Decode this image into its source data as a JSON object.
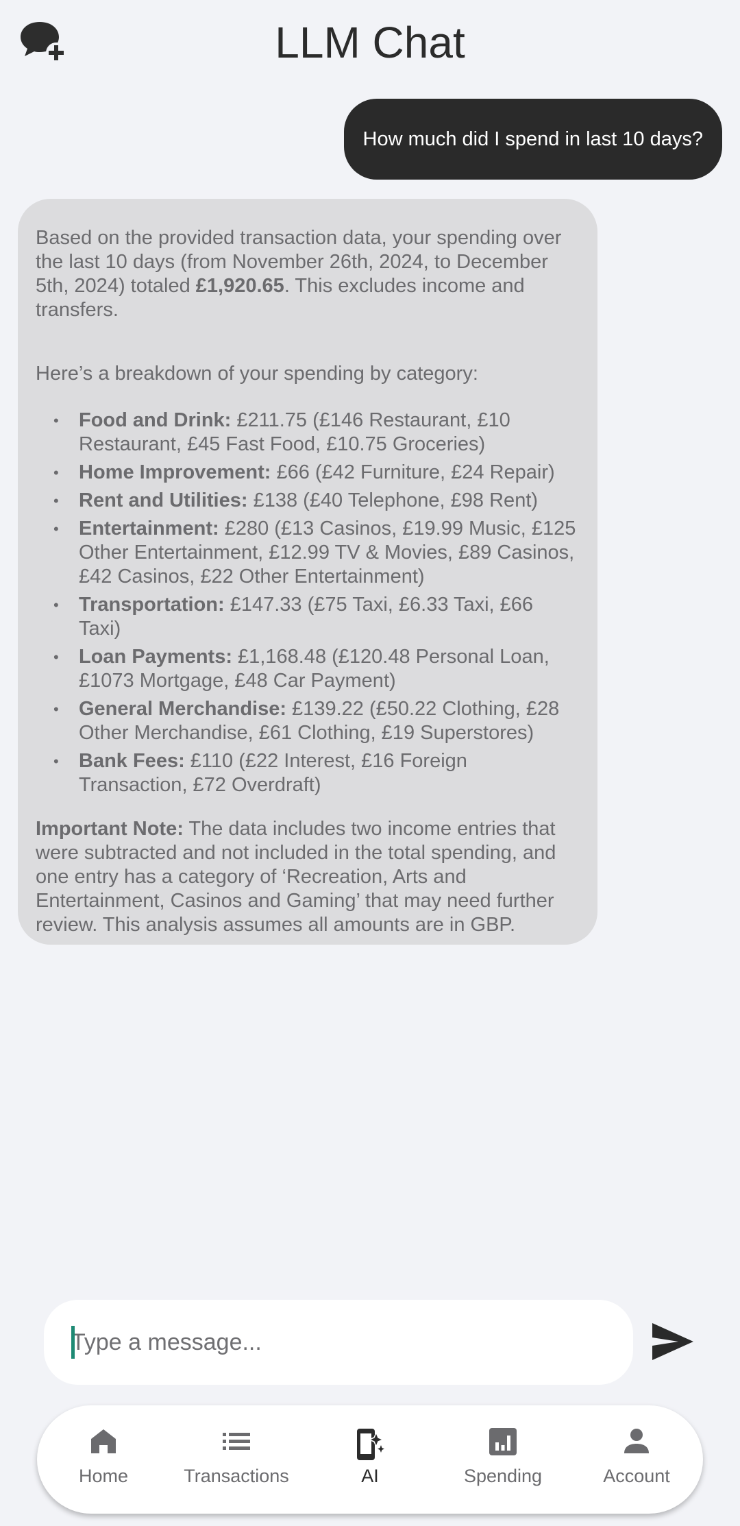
{
  "header": {
    "title": "LLM Chat",
    "new_chat_icon": "chat-bubbles-plus-icon"
  },
  "conversation": {
    "user_message": "How much did I spend in last 10 days?",
    "ai_response": {
      "intro_text_1": "Based on the provided transaction data, your spending over the last 10 days (from November 26th, 2024, to December 5th, 2024) totaled ",
      "intro_total": "£1,920.65",
      "intro_text_2": ".  This excludes income and transfers.",
      "breakdown_intro": "Here’s a breakdown of your spending by category:",
      "categories": [
        {
          "name": "Food and Drink:",
          "detail": " £211.75 (£146 Restaurant, £10 Restaurant, £45 Fast Food, £10.75 Groceries)"
        },
        {
          "name": "Home Improvement:",
          "detail": " £66 (£42 Furniture, £24 Repair)"
        },
        {
          "name": "Rent and Utilities:",
          "detail": " £138 (£40 Telephone, £98 Rent)"
        },
        {
          "name": "Entertainment:",
          "detail": " £280 (£13 Casinos, £19.99 Music, £125 Other Entertainment, £12.99 TV & Movies, £89 Casinos, £42 Casinos, £22 Other Entertainment)"
        },
        {
          "name": "Transportation:",
          "detail": " £147.33 (£75 Taxi, £6.33 Taxi, £66 Taxi)"
        },
        {
          "name": "Loan Payments:",
          "detail": " £1,168.48 (£120.48 Personal Loan, £1073 Mortgage, £48 Car Payment)"
        },
        {
          "name": "General Merchandise:",
          "detail": " £139.22 (£50.22 Clothing, £28 Other Merchandise, £61 Clothing, £19 Superstores)"
        },
        {
          "name": "Bank Fees:",
          "detail": " £110 (£22 Interest, £16 Foreign Transaction, £72 Overdraft)"
        }
      ],
      "note_label": "Important Note:",
      "note_text": " The data includes two income entries that were subtracted and not included in the total spending, and one entry has a category of ‘Recreation, Arts and Entertainment, Casinos and Gaming’ that may need further review.  This analysis assumes all amounts are in GBP."
    }
  },
  "composer": {
    "placeholder": "Type a message...",
    "value": "",
    "send_icon": "send-icon"
  },
  "bottom_nav": {
    "items": [
      {
        "label": "Home",
        "icon": "home-icon",
        "active": false
      },
      {
        "label": "Transactions",
        "icon": "list-icon",
        "active": false
      },
      {
        "label": "AI",
        "icon": "ai-phone-sparkle-icon",
        "active": true
      },
      {
        "label": "Spending",
        "icon": "bar-chart-icon",
        "active": false
      },
      {
        "label": "Account",
        "icon": "person-icon",
        "active": false
      }
    ]
  },
  "colors": {
    "background": "#f2f3f7",
    "user_bubble": "#2a2a2a",
    "ai_bubble": "#dcdcde",
    "caret_accent": "#1e8a74",
    "nav_active": "#2b2b2b",
    "nav_inactive": "#6b6b6e"
  }
}
